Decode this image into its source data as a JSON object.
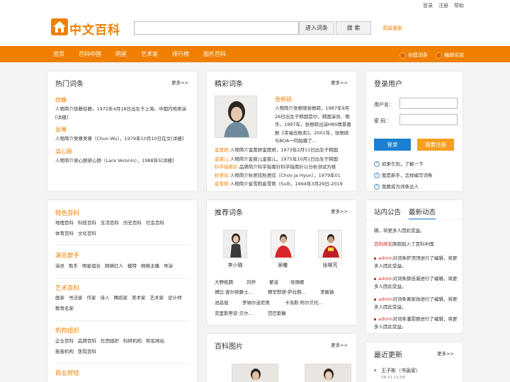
{
  "topbar": {
    "login": "登录",
    "register": "注册",
    "help": "帮助"
  },
  "logo": {
    "text": "中文百科"
  },
  "search": {
    "value": "",
    "placeholder": "",
    "entry_button": "进入词条",
    "search_button": "搜 索",
    "advanced": "高级搜索"
  },
  "nav": {
    "items": [
      "首页",
      "百科中国",
      "明星",
      "艺术家",
      "排行榜",
      "图片百科"
    ],
    "right": [
      {
        "label": "创建词条",
        "icon": "edit-icon"
      },
      {
        "label": "编辑实验",
        "icon": "experiment-icon"
      }
    ]
  },
  "hot": {
    "title": "热门词条",
    "more": "更多>>",
    "items": [
      {
        "name": "徐静",
        "desc": "人物简介徐静徐静，1972年4月18日出生于上海，中国内地男演[详细]"
      },
      {
        "name": "吴尊",
        "desc": "人物简介吴尊吴尊（Chun Wu），1979年10月10日在文[详细]"
      },
      {
        "name": "梁心颐",
        "desc": "人物简介梁心颐梁心颐（Lara Veronin），1988年5[详细]"
      }
    ]
  },
  "categories": [
    {
      "title": "特色百科",
      "items": [
        "地理百科",
        "科技百科",
        "生活百科",
        "历史百科",
        "社会百科",
        "体育百科",
        "文化百科"
      ]
    },
    {
      "title": "演员歌手",
      "items": [
        "演员",
        "歌手",
        "明星组合",
        "网络红人",
        "模特",
        "网络主播",
        "导演"
      ]
    },
    {
      "title": "艺术百科",
      "items": [
        "画家",
        "书法家",
        "作家",
        "诗人",
        "舞蹈家",
        "美术家",
        "艺术家",
        "设计师",
        "教育名家"
      ]
    },
    {
      "title": "机构组织",
      "items": [
        "企业百科",
        "品牌百科",
        "社团组织",
        "科研机构",
        "知名网站",
        "慈善机构",
        "医院百科"
      ]
    },
    {
      "title": "商业财经",
      "items": []
    }
  ],
  "featured": {
    "title": "精彩词条",
    "more": "更多>>",
    "main_name": "张根硕",
    "main_desc": "人物简介张根硕张根硕，1987年9月26日出生于韩国首尔，韩国演员、歌手。1997年，张根硕出演HBS情景喜剧《幸福也账卖》。2001年，张根硕与BOA一同拍摄了...",
    "rows": [
      {
        "label": "金度妍:",
        "text": "人物简介金度妍金度妍，1973年2月11日出生于韩国"
      },
      {
        "label": "金窗儿:",
        "text": "人物简介金窗儿金窗儿，1975年10月1日出生于韩国"
      },
      {
        "label": "科学指南针:",
        "text": "品牌简介科学指南针科学指南针以分析测试为核"
      },
      {
        "label": "秋瓷炫:",
        "text": "人物简介秋瓷炫秋瓷炫（Choo Ja Hyun），1979年01"
      },
      {
        "label": "崔雪莉:",
        "text": "人物简介崔雪莉崔雪莉（Sulli，1994年3月29日-2019"
      }
    ]
  },
  "recommend": {
    "title": "推荐词条",
    "more": "更多>>",
    "avatars": [
      "李小璐",
      "吴曦",
      "张琳芃"
    ],
    "names": [
      [
        "大野拓朗",
        "刘烨",
        "翟凌",
        "张丽娜"
      ],
      [
        "博比·查尔顿爵士...",
        "穆罕默德·萨拉赫...",
        "李敏镐"
      ],
      [
        "池昌旭",
        "罗纳尔迪尼奥",
        "卡洛斯·阿尔贝托..."
      ],
      [
        "克里斯蒂安·贝尔...",
        "范巴斯滕"
      ]
    ]
  },
  "pictures": {
    "title": "百科图片",
    "more": "更多>>"
  },
  "login": {
    "title": "登录用户",
    "username_label": "用户名：",
    "password_label": "密  码：",
    "login_button": "登录",
    "register_button": "我要注册",
    "help": [
      "初来乍到，了解一下",
      "我是新手，怎样编写词条",
      "我要成为词条达人"
    ]
  },
  "news": {
    "tabs": [
      "站内公告",
      "最新动态"
    ],
    "items": [
      {
        "user": "",
        "text": "辑，将更多人因此受益。"
      },
      {
        "user": "百科网友",
        "text": "刚刚加入了百科中国"
      },
      {
        "user": "admin",
        "text": "对词条萨顶顶进行了编辑，将更多人因此受益。"
      },
      {
        "user": "admin",
        "text": "对词条薛佳凝进行了编辑，将更多人因此受益。"
      },
      {
        "user": "admin",
        "text": "对词条黄家驹进行了编辑，将更多人因此受益。"
      },
      {
        "user": "admin",
        "text": "对词条潘雯丽进行了编辑，将更多人因此受益。"
      }
    ]
  },
  "recent": {
    "title": "最近更新",
    "more": "更多>>",
    "items": [
      {
        "name": "王子彬（书画家）",
        "time": "08-31 11:09"
      }
    ]
  },
  "colors": {
    "brand": "#f07f00",
    "login_blue": "#1a7fd0",
    "news_red": "#d03030"
  }
}
